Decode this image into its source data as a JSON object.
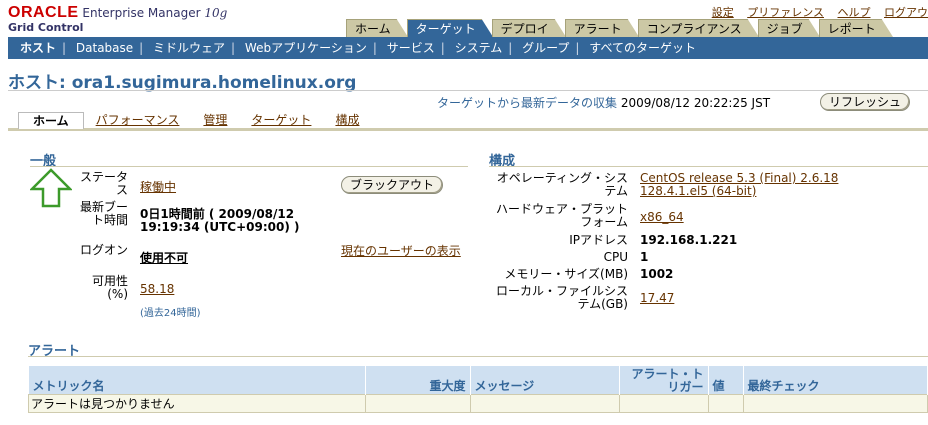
{
  "header": {
    "oracle": "ORACLE",
    "product": "Enterprise Manager",
    "version": "10g",
    "subtitle": "Grid Control",
    "global_links": [
      "設定",
      "プリファレンス",
      "ヘルプ",
      "ログアウ"
    ]
  },
  "tabs": [
    "ホーム",
    "ターゲット",
    "デプロイ",
    "アラート",
    "コンプライアンス",
    "ジョブ",
    "レポート"
  ],
  "subnav": [
    "ホスト",
    "Database",
    "ミドルウェア",
    "Webアプリケーション",
    "サービス",
    "システム",
    "グループ",
    "すべてのターゲット"
  ],
  "page": {
    "title": "ホスト: ora1.sugimura.homelinux.org",
    "collect_label": "ターゲットから最新データの収集",
    "collect_time": "2009/08/12 20:22:25 JST",
    "refresh_label": "リフレッシュ"
  },
  "subtabs": [
    "ホーム",
    "パフォーマンス",
    "管理",
    "ターゲット",
    "構成"
  ],
  "general": {
    "heading": "一般",
    "status_label": "ステータス",
    "status_value": "稼働中",
    "blackout_label": "ブラックアウト",
    "boot_label": "最新ブート時間",
    "boot_value_1": "0日1時間前 ( 2009/08/12",
    "boot_value_2": "19:19:34 (UTC+09:00) )",
    "logon_label": "ログオン",
    "logon_value": "使用不可",
    "current_user_link": "現在のユーザーの表示",
    "availability_label": "可用性(%)",
    "availability_value": "58.18",
    "availability_note": "(過去24時間)"
  },
  "config": {
    "heading": "構成",
    "rows": [
      {
        "label": "オペレーティング・システム",
        "value": "CentOS release 5.3 (Final) 2.6.18 128.4.1.el5 (64-bit)",
        "link": true
      },
      {
        "label": "ハードウェア・プラットフォーム",
        "value": "x86_64",
        "link": true
      },
      {
        "label": "IPアドレス",
        "value": "192.168.1.221",
        "link": false
      },
      {
        "label": "CPU",
        "value": "1",
        "link": false
      },
      {
        "label": "メモリー・サイズ(MB)",
        "value": "1002",
        "link": false
      },
      {
        "label": "ローカル・ファイルシステム(GB)",
        "value": "17.47",
        "link": true
      }
    ]
  },
  "alerts": {
    "heading": "アラート",
    "columns": [
      "メトリック名",
      "重大度",
      "メッセージ",
      "アラート・トリガー",
      "値",
      "最終チェック"
    ],
    "empty_text": "アラートは見つかりません"
  }
}
